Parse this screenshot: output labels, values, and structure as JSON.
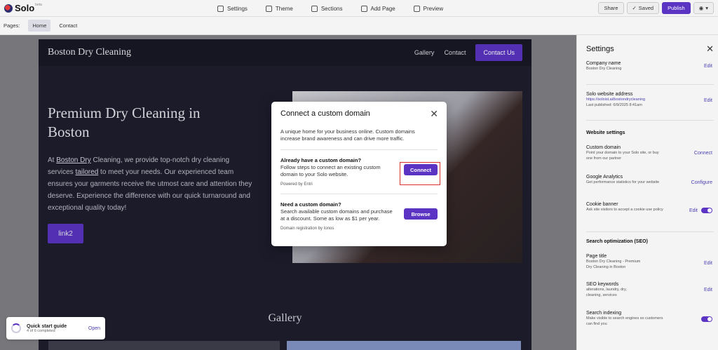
{
  "app": {
    "name": "Solo",
    "badge": "beta"
  },
  "toolbar": {
    "settings": "Settings",
    "theme": "Theme",
    "sections": "Sections",
    "add_page": "Add Page",
    "preview": "Preview",
    "share": "Share",
    "saved": "Saved",
    "publish": "Publish"
  },
  "pages": {
    "label": "Pages:",
    "items": [
      "Home",
      "Contact"
    ],
    "active": "Home"
  },
  "site": {
    "brand": "Boston Dry Cleaning",
    "nav": [
      "Gallery",
      "Contact",
      "Contact Us"
    ],
    "hero_title": "Premium Dry Cleaning in Boston",
    "hero_body_1": "At ",
    "hero_link_1": "Boston Dry",
    "hero_body_2": " Cleaning, we provide top-notch dry cleaning services ",
    "hero_link_2": "tailored",
    "hero_body_3": " to meet your needs. Our experienced team ensures your garments receive the utmost care and attention they deserve. Experience the difference with our quick turnaround and exceptional quality today!",
    "hero_button": "link2",
    "gallery_heading": "Gallery"
  },
  "modal": {
    "title": "Connect a custom domain",
    "description": "A unique home for your business online. Custom domains increase brand awareness and can drive more traffic.",
    "have_title": "Already have a custom domain?",
    "have_desc": "Follow steps to connect an existing custom domain to your Solo website.",
    "have_small": "Powered by Entri",
    "connect": "Connect",
    "need_title": "Need a custom domain?",
    "need_desc": "Search available custom domains and purchase at a discount. Some as low as $1 per year.",
    "need_small": "Domain registration by Ionos",
    "browse": "Browse"
  },
  "settings": {
    "title": "Settings",
    "company_name_label": "Company name",
    "company_name_value": "Boston Dry Cleaning",
    "address_label": "Solo website address",
    "address_value": "https://soloist.ai/bostondrycleaning",
    "address_published": "Last published: 6/9/2025 8:41am",
    "website_settings": "Website settings",
    "custom_domain_label": "Custom domain",
    "custom_domain_desc": "Point your domain to your Solo site, or buy one from our partner",
    "analytics_label": "Google Analytics",
    "analytics_desc": "Get performance statistics for your website",
    "cookie_label": "Cookie banner",
    "cookie_desc": "Ask site visitors to accept a cookie use policy",
    "seo_heading": "Search optimization (SEO)",
    "page_title_label": "Page title",
    "page_title_value": "Boston Dry Cleaning - Premium Dry Cleaning in Boston",
    "seo_keywords_label": "SEO keywords",
    "seo_keywords_value": "alterations, laundry, dry, cleaning, services",
    "indexing_label": "Search indexing",
    "indexing_desc": "Make visible to search engines so customers can find you",
    "edit": "Edit",
    "connect": "Connect",
    "configure": "Configure"
  },
  "quickstart": {
    "title": "Quick start guide",
    "progress": "4 of 6 completed",
    "open": "Open"
  }
}
